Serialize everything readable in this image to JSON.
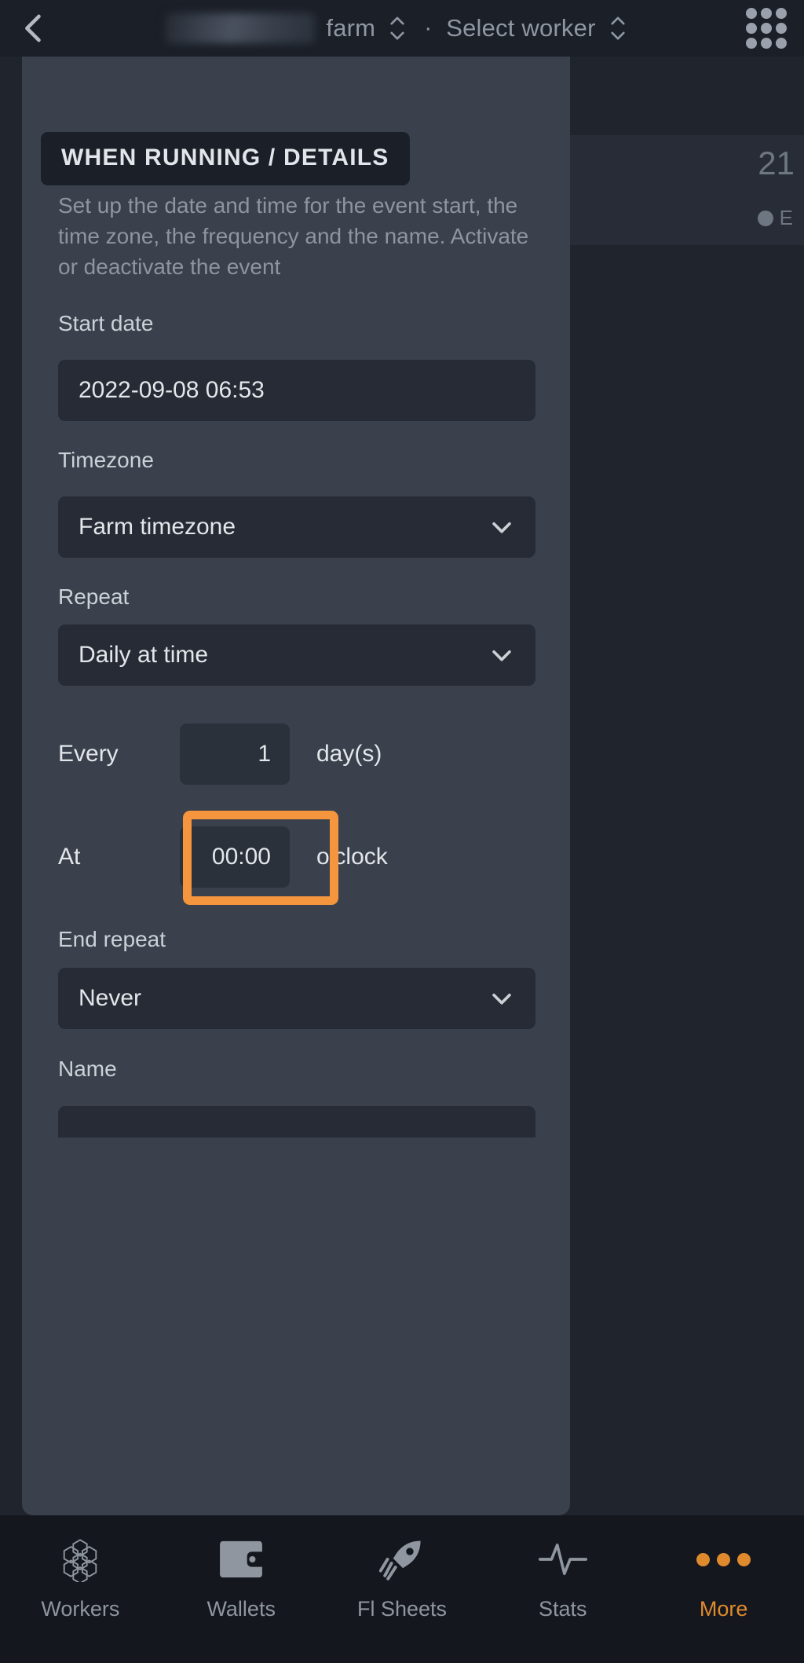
{
  "topbar": {
    "back_icon": "chevron-left-icon",
    "farm_label": "farm",
    "separator": "·",
    "worker_label": "Select worker",
    "menu_icon": "grid-menu-icon"
  },
  "background": {
    "number": "21",
    "sub_label": "E"
  },
  "sheet": {
    "section_badge": "WHEN RUNNING / DETAILS",
    "section_description": "Set up the date and time for the event start, the time zone, the frequency and the name. Activate or deactivate the event",
    "fields": {
      "start_date": {
        "label": "Start date",
        "value": "2022-09-08 06:53"
      },
      "timezone": {
        "label": "Timezone",
        "value": "Farm timezone",
        "chevron": "chevron-down-icon"
      },
      "repeat": {
        "label": "Repeat",
        "value": "Daily at time",
        "chevron": "chevron-down-icon"
      },
      "every": {
        "label": "Every",
        "value": "1",
        "unit": "day(s)"
      },
      "at": {
        "label": "At",
        "value": "00:00",
        "unit": "o'clock",
        "highlighted": true
      },
      "end_repeat": {
        "label": "End repeat",
        "value": "Never",
        "chevron": "chevron-down-icon"
      },
      "name": {
        "label": "Name",
        "value": ""
      }
    }
  },
  "bottom_nav": {
    "items": [
      {
        "label": "Workers",
        "icon": "hexagon-cluster-icon",
        "active": false
      },
      {
        "label": "Wallets",
        "icon": "wallet-icon",
        "active": false
      },
      {
        "label": "Fl Sheets",
        "icon": "rocket-icon",
        "active": false
      },
      {
        "label": "Stats",
        "icon": "pulse-icon",
        "active": false
      },
      {
        "label": "More",
        "icon": "ellipsis-icon",
        "active": true
      }
    ]
  },
  "colors": {
    "accent_orange": "#f5953d",
    "active_nav": "#e08a2e",
    "sheet_bg": "#3a414c",
    "input_bg": "#262b35",
    "page_bg": "#20242d",
    "topbar_bg": "#1b1f28",
    "nav_bg": "#14171e"
  }
}
